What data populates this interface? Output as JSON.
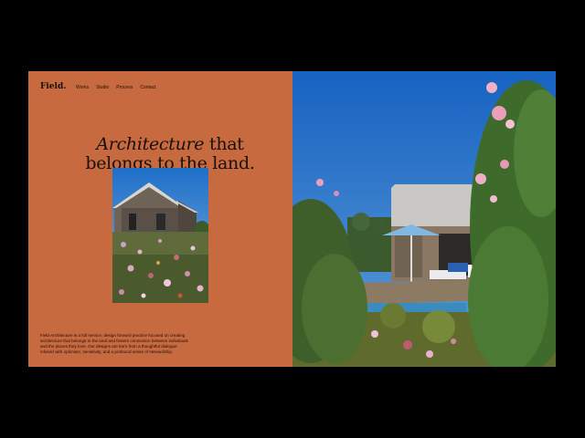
{
  "brand": {
    "logo": "Field."
  },
  "nav": {
    "items": [
      "Works",
      "Studio",
      "Process",
      "Contact"
    ]
  },
  "hero": {
    "headline_em": "Architecture",
    "headline_rest_1": " that",
    "headline_line2": "belongs to the land."
  },
  "intro": {
    "text": "Field Architecture is a full service, design forward practice focused on creating architecture that belongs to the land and fosters connection between individuals and the places they love. Our designs are born from a thoughtful dialogue infused with optimism, sensitivity, and a profound sense of stewardship."
  },
  "colors": {
    "panel": "#c86a3f",
    "background": "#000000",
    "text": "#1a0f0a"
  }
}
